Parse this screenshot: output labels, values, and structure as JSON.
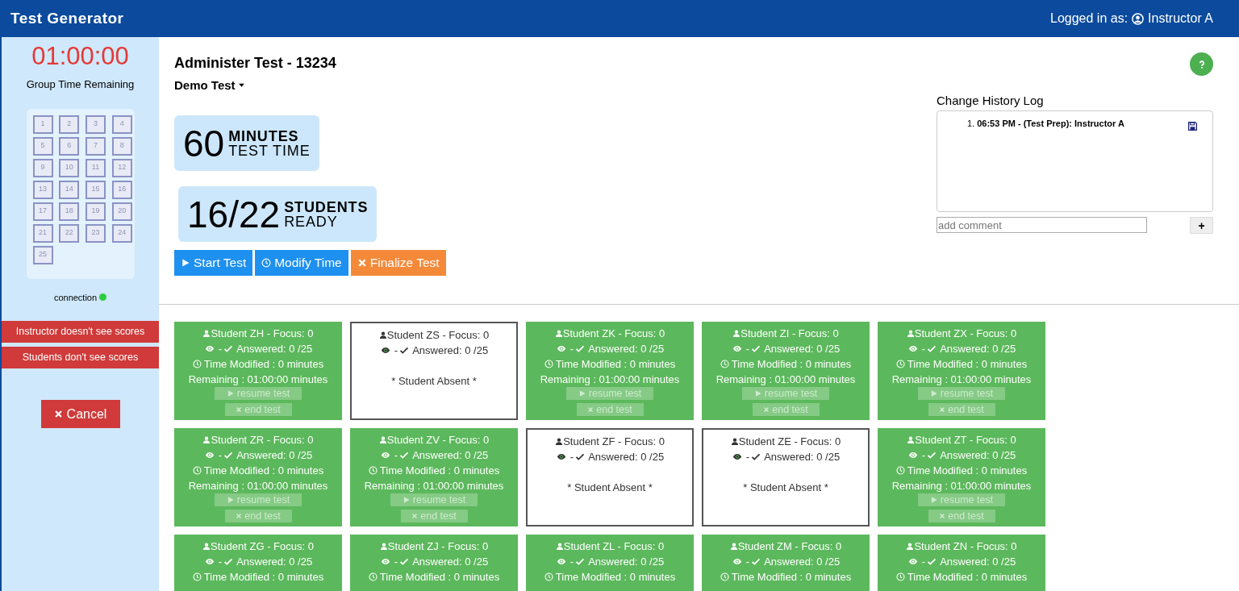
{
  "header": {
    "title": "Test Generator",
    "login_label": "Logged in as:",
    "user": "Instructor A"
  },
  "sidebar": {
    "timer": "01:00:00",
    "timer_label": "Group Time Remaining",
    "questions": [
      "1",
      "2",
      "3",
      "4",
      "5",
      "6",
      "7",
      "8",
      "9",
      "10",
      "11",
      "12",
      "13",
      "14",
      "15",
      "16",
      "17",
      "18",
      "19",
      "20",
      "21",
      "22",
      "23",
      "24",
      "25"
    ],
    "connection": {
      "label": "connection",
      "connected": true
    },
    "notices": [
      "Instructor doesn't see scores",
      "Students don't see scores"
    ],
    "cancel_button": "Cancel"
  },
  "test": {
    "title": "Administer Test - 13234",
    "name": "Demo Test",
    "time_card": {
      "number": "60",
      "unit": "MINUTES",
      "caption": "TEST TIME"
    },
    "students_card": {
      "number": "16/22",
      "unit": "STUDENTS",
      "caption": "READY"
    },
    "buttons": [
      {
        "kind": "start",
        "label": "Start Test"
      },
      {
        "kind": "modify",
        "label": "Modify Time"
      },
      {
        "kind": "finalize",
        "label": "Finalize Test"
      }
    ]
  },
  "history": {
    "title": "Change History Log",
    "entries": [
      {
        "number": "1.",
        "text": "06:53 PM - (Test Prep): Instructor A"
      }
    ],
    "comment_placeholder": "add comment",
    "add_button": "+"
  },
  "students": [
    {
      "kind": "present",
      "title": "Student ZH - Focus: 0",
      "separator": "-",
      "answered": "Answered: 0 /25",
      "time_modified": "Time Modified : 0 minutes",
      "remaining": "Remaining : 01:00:00 minutes",
      "resume": "resume test",
      "end": "end test"
    },
    {
      "kind": "absent",
      "title": "Student ZS - Focus: 0",
      "separator": "-",
      "answered": "Answered: 0 /25",
      "note": "* Student Absent *"
    },
    {
      "kind": "present",
      "title": "Student ZK - Focus: 0",
      "separator": "-",
      "answered": "Answered: 0 /25",
      "time_modified": "Time Modified : 0 minutes",
      "remaining": "Remaining : 01:00:00 minutes",
      "resume": "resume test",
      "end": "end test"
    },
    {
      "kind": "present",
      "title": "Student ZI - Focus: 0",
      "separator": "-",
      "answered": "Answered: 0 /25",
      "time_modified": "Time Modified : 0 minutes",
      "remaining": "Remaining : 01:00:00 minutes",
      "resume": "resume test",
      "end": "end test"
    },
    {
      "kind": "present",
      "title": "Student ZX - Focus: 0",
      "separator": "-",
      "answered": "Answered: 0 /25",
      "time_modified": "Time Modified : 0 minutes",
      "remaining": "Remaining : 01:00:00 minutes",
      "resume": "resume test",
      "end": "end test"
    },
    {
      "kind": "present",
      "title": "Student ZR - Focus: 0",
      "separator": "-",
      "answered": "Answered: 0 /25",
      "time_modified": "Time Modified : 0 minutes",
      "remaining": "Remaining : 01:00:00 minutes",
      "resume": "resume test",
      "end": "end test"
    },
    {
      "kind": "present",
      "title": "Student ZV - Focus: 0",
      "separator": "-",
      "answered": "Answered: 0 /25",
      "time_modified": "Time Modified : 0 minutes",
      "remaining": "Remaining : 01:00:00 minutes",
      "resume": "resume test",
      "end": "end test"
    },
    {
      "kind": "absent",
      "title": "Student ZF - Focus: 0",
      "separator": "-",
      "answered": "Answered: 0 /25",
      "note": "* Student Absent *"
    },
    {
      "kind": "absent",
      "title": "Student ZE - Focus: 0",
      "separator": "-",
      "answered": "Answered: 0 /25",
      "note": "* Student Absent *"
    },
    {
      "kind": "present",
      "title": "Student ZT - Focus: 0",
      "separator": "-",
      "answered": "Answered: 0 /25",
      "time_modified": "Time Modified : 0 minutes",
      "remaining": "Remaining : 01:00:00 minutes",
      "resume": "resume test",
      "end": "end test"
    },
    {
      "kind": "present",
      "title": "Student ZG - Focus: 0",
      "separator": "-",
      "answered": "Answered: 0 /25",
      "time_modified": "Time Modified : 0 minutes"
    },
    {
      "kind": "present",
      "title": "Student ZJ - Focus: 0",
      "separator": "-",
      "answered": "Answered: 0 /25",
      "time_modified": "Time Modified : 0 minutes"
    },
    {
      "kind": "present",
      "title": "Student ZL - Focus: 0",
      "separator": "-",
      "answered": "Answered: 0 /25",
      "time_modified": "Time Modified : 0 minutes"
    },
    {
      "kind": "present",
      "title": "Student ZM - Focus: 0",
      "separator": "-",
      "answered": "Answered: 0 /25",
      "time_modified": "Time Modified : 0 minutes"
    },
    {
      "kind": "present",
      "title": "Student ZN - Focus: 0",
      "separator": "-",
      "answered": "Answered: 0 /25",
      "time_modified": "Time Modified : 0 minutes"
    }
  ]
}
